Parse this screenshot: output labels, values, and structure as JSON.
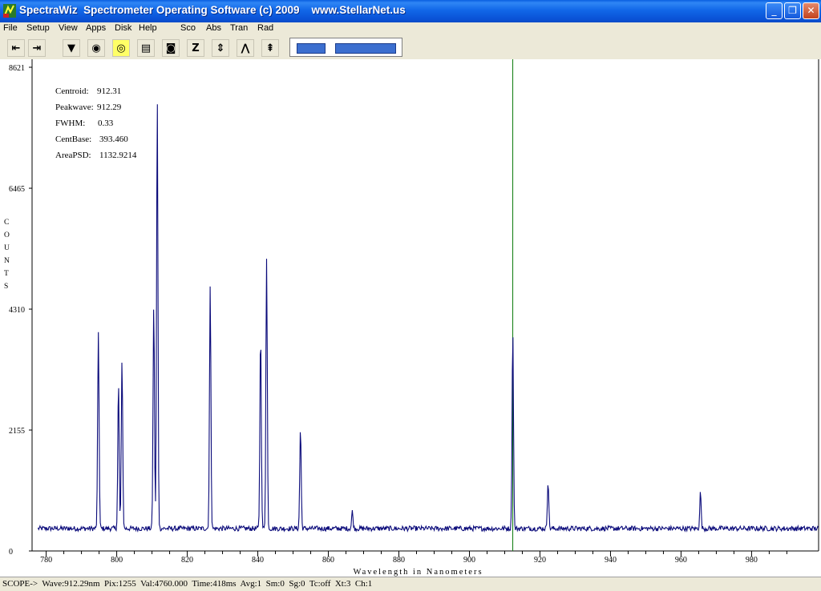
{
  "window": {
    "title": "SpectraWiz  Spectrometer Operating Software (c) 2009    www.StellarNet.us",
    "controls": {
      "minimize": "_",
      "maximize": "❐",
      "close": "✕"
    }
  },
  "menu": [
    "File",
    "Setup",
    "View",
    "Apps",
    "Disk",
    "Help",
    "Sco",
    "Abs",
    "Tran",
    "Rad"
  ],
  "toolbar": {
    "buttons": [
      {
        "name": "scroll-left-button",
        "glyph": "⇤",
        "icon": "arrow-left-bar-icon"
      },
      {
        "name": "scroll-right-button",
        "glyph": "⇥",
        "icon": "arrow-right-bar-icon"
      },
      {
        "name": "save-spectrum-button",
        "glyph": "▼",
        "icon": "download-icon"
      },
      {
        "name": "detector-button",
        "glyph": "◉",
        "icon": "detector-icon"
      },
      {
        "name": "lamp-button",
        "glyph": "💡",
        "icon": "lightbulb-icon"
      },
      {
        "name": "print-button",
        "glyph": "▤",
        "icon": "printer-icon"
      },
      {
        "name": "snapshot-button",
        "glyph": "◙",
        "icon": "camera-icon"
      },
      {
        "name": "zero-button",
        "glyph": "Z",
        "icon": "zero-icon"
      },
      {
        "name": "autoscale-button",
        "glyph": "⇕",
        "icon": "autoscale-icon"
      },
      {
        "name": "peaks-button",
        "glyph": "⋀",
        "icon": "peaks-icon"
      },
      {
        "name": "baseline-button",
        "glyph": "⇞",
        "icon": "baseline-icon"
      }
    ],
    "slider": {
      "left_value": 0.35,
      "right_value": 0.55
    }
  },
  "chart_data": {
    "type": "line",
    "title": "",
    "xlabel": "Wavelength  in  Nanometers",
    "ylabel": "COUNTS",
    "xlim": [
      776,
      999
    ],
    "ylim": [
      0,
      8621
    ],
    "x_ticks": [
      780,
      800,
      820,
      840,
      860,
      880,
      900,
      920,
      940,
      960,
      980
    ],
    "y_ticks": [
      0,
      2155,
      4310,
      6465,
      8621
    ],
    "baseline": 400,
    "cursor_x": 912.29,
    "cursor_color": "#0a7a0a",
    "line_color": "#0a0a7a",
    "peaks": [
      {
        "x": 794.8,
        "y": 3900
      },
      {
        "x": 800.5,
        "y": 3000
      },
      {
        "x": 801.5,
        "y": 3400
      },
      {
        "x": 810.5,
        "y": 4400
      },
      {
        "x": 811.5,
        "y": 8100
      },
      {
        "x": 826.5,
        "y": 4700
      },
      {
        "x": 840.8,
        "y": 3900
      },
      {
        "x": 842.5,
        "y": 5200
      },
      {
        "x": 852.1,
        "y": 2200
      },
      {
        "x": 866.8,
        "y": 700
      },
      {
        "x": 912.29,
        "y": 3900
      },
      {
        "x": 922.3,
        "y": 1250
      },
      {
        "x": 965.5,
        "y": 1050
      }
    ]
  },
  "stats": [
    {
      "label": "Centroid:",
      "value": "912.31"
    },
    {
      "label": "Peakwave:",
      "value": "912.29"
    },
    {
      "label": "FWHM:",
      "value": "0.33"
    },
    {
      "label": "CentBase:",
      "value": "393.460"
    },
    {
      "label": "AreaPSD:",
      "value": "1132.9214"
    }
  ],
  "status": "SCOPE->  Wave:912.29nm  Pix:1255  Val:4760.000  Time:418ms  Avg:1  Sm:0  Sg:0  Tc:off  Xt:3  Ch:1"
}
